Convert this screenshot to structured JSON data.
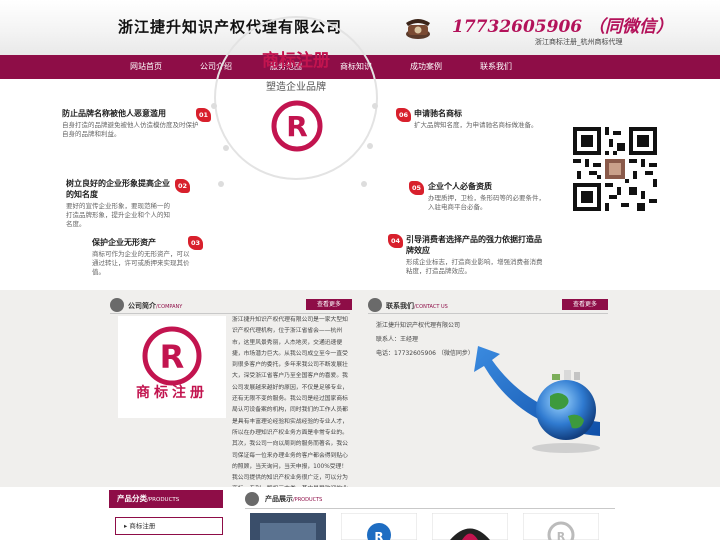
{
  "header": {
    "company_name": "浙江捷升知识产权代理有限公司",
    "phone": "17732605906 （同微信）",
    "phone_sub": "浙江商标注册_杭州商标代理"
  },
  "nav": {
    "items": [
      "网站首页",
      "公司介绍",
      "服务范围",
      "商标知识",
      "成功案例",
      "联系我们"
    ]
  },
  "banner": {
    "title": "商标注册",
    "subtitle": "塑造企业品牌",
    "features": [
      {
        "num": "01",
        "title": "防止品牌名称被他人恶意滥用",
        "desc": "自身打造的品牌避免被他人仿造模仿度及时保护自身的品牌和利益。"
      },
      {
        "num": "02",
        "title": "树立良好的企业形象提高企业的知名度",
        "desc": "要好的宣传企业形象，要现范稀一的打造品牌形象，提升企业和个人的知名度。"
      },
      {
        "num": "03",
        "title": "保护企业无形资产",
        "desc": "商标可作为企业的无形资产，可以通过转让，许可或质押来实现其价值。"
      },
      {
        "num": "06",
        "title": "申请驰名商标",
        "desc": "扩大品牌知名度，为申请驰名商标做准备。"
      },
      {
        "num": "05",
        "title": "企业个人必备资质",
        "desc": "办理质押，卫检，条形码等的必要条件，入驻电商平台必备。"
      },
      {
        "num": "04",
        "title": "引导消费者选择产品的强力依据打造品牌效应",
        "desc": "形成企业标志，打造商业影响，增强消费者消费粘度，打造品牌效应。"
      }
    ]
  },
  "about": {
    "title": "公司简介",
    "title_en": "/COMPANY",
    "more": "查看更多",
    "logo_text": "商标注册",
    "text": "浙江捷升知识产权代理有限公司是一家大型知识产权代理机构，位于浙江省省会——杭州市，这里风景秀丽，人杰地灵，交通迅速便捷，市场潜力巨大。从我公司成立至今一直受到很多客户的委托，多年来我公司不断发展壮大，深受浙江省客户乃至全国客户的喜爱。我公司发展越来越好的原因，不仅是足够专业，还有无限不变的服务。我公司是经过国家商标局认可设备案的机构，同时我们的工作人员都是具有丰富理论经验和实战经验的专业人才，所以在办理知识产权业务方面是非常专业的。其次，我公司一向以周到的服务而著名，我公司保证每一位来办理业务的客户都会得到贴心的照顾，当天询问，当天申报，100%受理！我公司提供的知识产权业务很广泛，可以分为商标、专利、版权三大类，其中最受欢迎的业务就是浙江商标注册和杭州商标注册两大类，在浙江省内收到了很多为委托人的好评！"
  },
  "contact": {
    "title": "联系我们",
    "title_en": "/CONTACT US",
    "more": "查看更多",
    "company": "浙江捷升知识产权代理有限公司",
    "person": "联系人：王经理",
    "phone": "电话：17732605906 （微信同步）"
  },
  "products": {
    "cat_title": "产品分类",
    "cat_title_en": "/PRODUCTS",
    "cat_item": "商标注册",
    "show_title": "产品展示",
    "show_title_en": "/PRODUCTS"
  },
  "colors": {
    "accent": "#8e0d47",
    "badge": "#d8202c",
    "title_red": "#c2144f"
  }
}
